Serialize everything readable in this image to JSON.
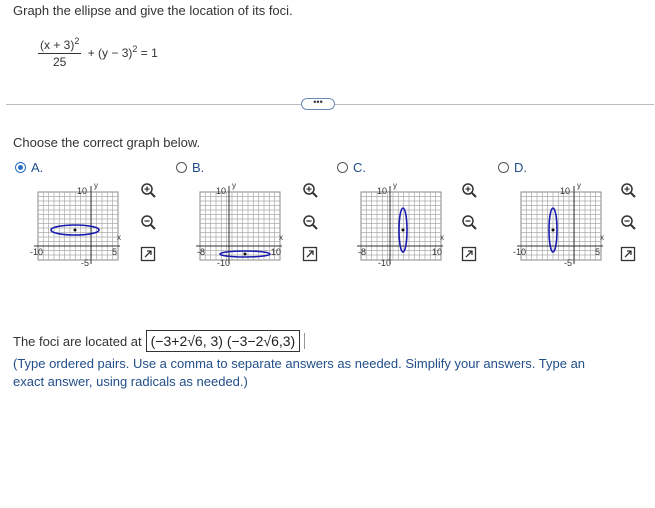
{
  "question": "Graph the ellipse and give the location of its foci.",
  "equation": {
    "numerator": "(x + 3)",
    "numerator_exp": "2",
    "denominator": "25",
    "rest": "+ (y − 3)",
    "rest_exp": "2",
    "rhs": "= 1"
  },
  "more_button": "•••",
  "choose_prompt": "Choose the correct graph below.",
  "options": [
    {
      "label": "A.",
      "selected": true,
      "ytick": "10",
      "xmin": "-10",
      "xmax": "5",
      "ymin": "-5",
      "xaxis": "x",
      "yaxis": "y"
    },
    {
      "label": "B.",
      "selected": false,
      "ytick": "10",
      "xmin": "-8",
      "xmax": "10",
      "ymin": "-10",
      "xaxis": "x",
      "yaxis": "y"
    },
    {
      "label": "C.",
      "selected": false,
      "ytick": "10",
      "xmin": "-8",
      "xmax": "10",
      "ymin": "-10",
      "xaxis": "x",
      "yaxis": "y"
    },
    {
      "label": "D.",
      "selected": false,
      "ytick": "10",
      "xmin": "-10",
      "xmax": "5",
      "ymin": "-5",
      "xaxis": "x",
      "yaxis": "y"
    }
  ],
  "foci_prefix": "The foci are located at",
  "foci_answer": "(−3+2√6, 3) (−3−2√6,3)",
  "hint": "(Type ordered pairs. Use a comma to separate answers as needed. Simplify your answers. Type an exact answer, using radicals as needed.)",
  "colors": {
    "accent": "#2a6fc8",
    "ellipse": "#1a1ab0",
    "grid": "#999999"
  }
}
